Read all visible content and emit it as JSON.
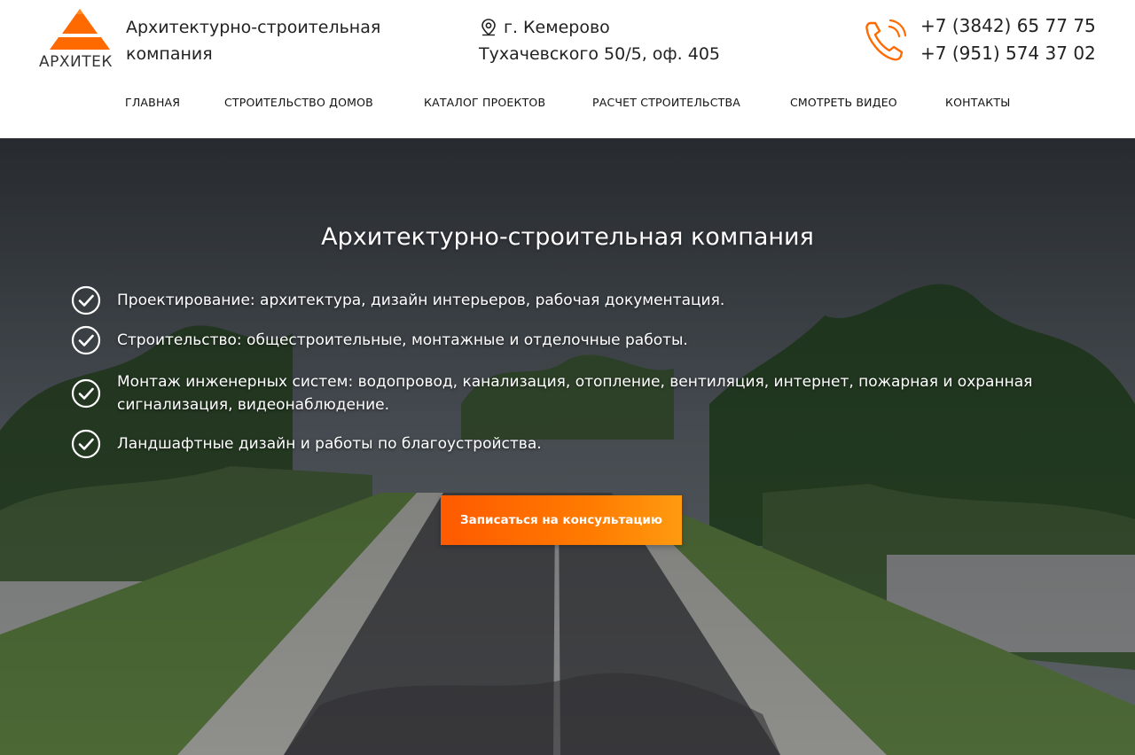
{
  "header": {
    "logo_text": "АРХИТЕК",
    "company_name": "Архитектурно-строительная компания",
    "address_city": "г. Кемерово",
    "address_street": "Тухачевского 50/5, оф. 405",
    "phones": [
      "+7 (3842) 65 77 75",
      "+7 (951) 574 37 02"
    ],
    "brand_color": "#ff6a00"
  },
  "nav": {
    "items": [
      {
        "label": "ГЛАВНАЯ"
      },
      {
        "label": "СТРОИТЕЛЬСТВО ДОМОВ"
      },
      {
        "label": "КАТАЛОГ ПРОЕКТОВ"
      },
      {
        "label": "РАСЧЕТ СТРОИТЕЛЬСТВА"
      },
      {
        "label": "СМОТРЕТЬ ВИДЕО"
      },
      {
        "label": "КОНТАКТЫ"
      }
    ]
  },
  "hero": {
    "title": "Архитектурно-строительная компания",
    "features": [
      "Проектирование: архитектура, дизайн интерьеров, рабочая документация.",
      "Строительство: общестроительные, монтажные и отделочные работы.",
      "Монтаж инженерных систем: водопровод, канализация, отопление, вентиляция, интернет, пожарная и охранная сигнализация, видеонаблюдение.",
      "Ландшафтные дизайн и работы по благоустройства."
    ],
    "cta_label": "Записаться на консультацию",
    "icons": {
      "check": "check-circle-icon",
      "pin": "map-pin-icon",
      "phone": "phone-icon"
    }
  }
}
